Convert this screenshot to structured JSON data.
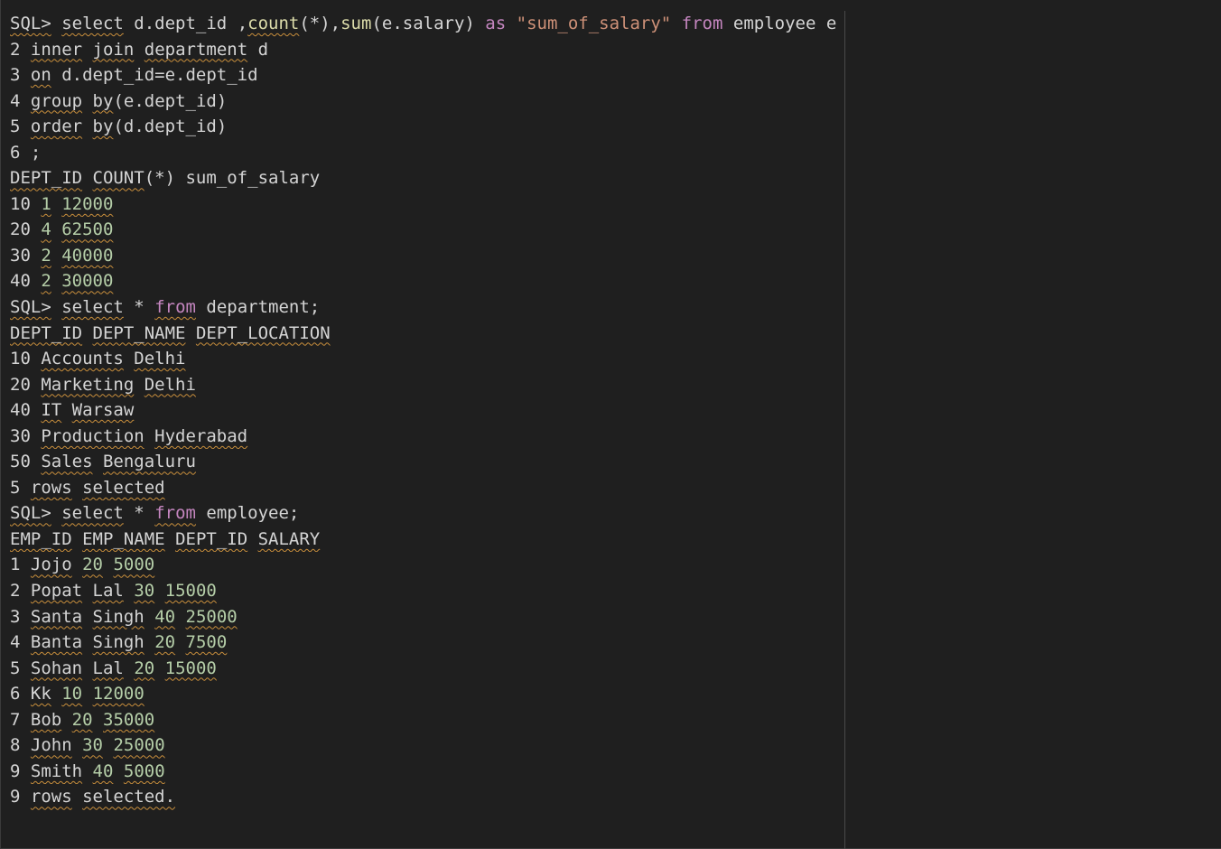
{
  "editor": {
    "lines": [
      [
        {
          "text": "SQL>",
          "kind": "plain",
          "squiggle": true
        },
        {
          "text": " ",
          "kind": "plain"
        },
        {
          "text": "select",
          "kind": "plain",
          "squiggle": true
        },
        {
          "text": " d.dept_id ,",
          "kind": "plain"
        },
        {
          "text": "count",
          "kind": "func",
          "squiggle": true
        },
        {
          "text": "(*),",
          "kind": "plain"
        },
        {
          "text": "sum",
          "kind": "func"
        },
        {
          "text": "(e.salary) ",
          "kind": "plain"
        },
        {
          "text": "as",
          "kind": "keyword"
        },
        {
          "text": " ",
          "kind": "plain"
        },
        {
          "text": "\"sum_of_salary\"",
          "kind": "string"
        },
        {
          "text": " ",
          "kind": "plain"
        },
        {
          "text": "from",
          "kind": "keyword"
        },
        {
          "text": " employee e",
          "kind": "plain"
        }
      ],
      [
        {
          "text": "2 ",
          "kind": "plain"
        },
        {
          "text": "inner",
          "kind": "plain",
          "squiggle": true
        },
        {
          "text": " ",
          "kind": "plain"
        },
        {
          "text": "join",
          "kind": "plain",
          "squiggle": true
        },
        {
          "text": " ",
          "kind": "plain"
        },
        {
          "text": "department",
          "kind": "plain",
          "squiggle": true
        },
        {
          "text": " d",
          "kind": "plain"
        }
      ],
      [
        {
          "text": "3 ",
          "kind": "plain"
        },
        {
          "text": "on",
          "kind": "plain",
          "squiggle": true
        },
        {
          "text": " d.dept_id=e.dept_id",
          "kind": "plain"
        }
      ],
      [
        {
          "text": "4 ",
          "kind": "plain"
        },
        {
          "text": "group",
          "kind": "plain",
          "squiggle": true
        },
        {
          "text": " ",
          "kind": "plain"
        },
        {
          "text": "by",
          "kind": "plain",
          "squiggle": true
        },
        {
          "text": "(e.dept_id)",
          "kind": "plain"
        }
      ],
      [
        {
          "text": "5 ",
          "kind": "plain"
        },
        {
          "text": "order",
          "kind": "plain",
          "squiggle": true
        },
        {
          "text": " ",
          "kind": "plain"
        },
        {
          "text": "by",
          "kind": "plain",
          "squiggle": true
        },
        {
          "text": "(d.dept_id)",
          "kind": "plain"
        }
      ],
      [
        {
          "text": "6 ;",
          "kind": "plain"
        }
      ],
      [
        {
          "text": "DEPT_ID",
          "kind": "plain",
          "squiggle": true
        },
        {
          "text": " ",
          "kind": "plain"
        },
        {
          "text": "COUNT",
          "kind": "plain",
          "squiggle": true
        },
        {
          "text": "(*) sum_of_salary",
          "kind": "plain"
        }
      ],
      [
        {
          "text": "10 ",
          "kind": "plain"
        },
        {
          "text": "1",
          "kind": "number",
          "squiggle": true
        },
        {
          "text": " ",
          "kind": "plain"
        },
        {
          "text": "12000",
          "kind": "number",
          "squiggle": true
        }
      ],
      [
        {
          "text": "20 ",
          "kind": "plain"
        },
        {
          "text": "4",
          "kind": "number",
          "squiggle": true
        },
        {
          "text": " ",
          "kind": "plain"
        },
        {
          "text": "62500",
          "kind": "number",
          "squiggle": true
        }
      ],
      [
        {
          "text": "30 ",
          "kind": "plain"
        },
        {
          "text": "2",
          "kind": "number",
          "squiggle": true
        },
        {
          "text": " ",
          "kind": "plain"
        },
        {
          "text": "40000",
          "kind": "number",
          "squiggle": true
        }
      ],
      [
        {
          "text": "40 ",
          "kind": "plain"
        },
        {
          "text": "2",
          "kind": "number",
          "squiggle": true
        },
        {
          "text": " ",
          "kind": "plain"
        },
        {
          "text": "30000",
          "kind": "number",
          "squiggle": true
        }
      ],
      [
        {
          "text": "SQL>",
          "kind": "plain",
          "squiggle": true
        },
        {
          "text": " ",
          "kind": "plain"
        },
        {
          "text": "select",
          "kind": "plain",
          "squiggle": true
        },
        {
          "text": " * ",
          "kind": "plain"
        },
        {
          "text": "from",
          "kind": "keyword",
          "squiggle": true
        },
        {
          "text": " department;",
          "kind": "plain"
        }
      ],
      [
        {
          "text": "DEPT_ID",
          "kind": "plain",
          "squiggle": true
        },
        {
          "text": " ",
          "kind": "plain"
        },
        {
          "text": "DEPT_NAME",
          "kind": "plain",
          "squiggle": true
        },
        {
          "text": " ",
          "kind": "plain"
        },
        {
          "text": "DEPT_LOCATION",
          "kind": "plain",
          "squiggle": true
        }
      ],
      [
        {
          "text": "10 ",
          "kind": "plain"
        },
        {
          "text": "Accounts",
          "kind": "plain",
          "squiggle": true
        },
        {
          "text": " ",
          "kind": "plain"
        },
        {
          "text": "Delhi",
          "kind": "plain",
          "squiggle": true
        }
      ],
      [
        {
          "text": "20 ",
          "kind": "plain"
        },
        {
          "text": "Marketing",
          "kind": "plain",
          "squiggle": true
        },
        {
          "text": " ",
          "kind": "plain"
        },
        {
          "text": "Delhi",
          "kind": "plain",
          "squiggle": true
        }
      ],
      [
        {
          "text": "40 ",
          "kind": "plain"
        },
        {
          "text": "IT",
          "kind": "plain",
          "squiggle": true
        },
        {
          "text": " ",
          "kind": "plain"
        },
        {
          "text": "Warsaw",
          "kind": "plain",
          "squiggle": true
        }
      ],
      [
        {
          "text": "30 ",
          "kind": "plain"
        },
        {
          "text": "Production",
          "kind": "plain",
          "squiggle": true
        },
        {
          "text": " ",
          "kind": "plain"
        },
        {
          "text": "Hyderabad",
          "kind": "plain",
          "squiggle": true
        }
      ],
      [
        {
          "text": "50 ",
          "kind": "plain"
        },
        {
          "text": "Sales",
          "kind": "plain",
          "squiggle": true
        },
        {
          "text": " ",
          "kind": "plain"
        },
        {
          "text": "Bengaluru",
          "kind": "plain",
          "squiggle": true
        }
      ],
      [
        {
          "text": "5 ",
          "kind": "plain"
        },
        {
          "text": "rows",
          "kind": "plain",
          "squiggle": true
        },
        {
          "text": " ",
          "kind": "plain"
        },
        {
          "text": "selected",
          "kind": "plain",
          "squiggle": true
        }
      ],
      [
        {
          "text": "SQL>",
          "kind": "plain",
          "squiggle": true
        },
        {
          "text": " ",
          "kind": "plain"
        },
        {
          "text": "select",
          "kind": "plain",
          "squiggle": true
        },
        {
          "text": " * ",
          "kind": "plain"
        },
        {
          "text": "from",
          "kind": "keyword",
          "squiggle": true
        },
        {
          "text": " employee;",
          "kind": "plain"
        }
      ],
      [
        {
          "text": "EMP_ID",
          "kind": "plain",
          "squiggle": true
        },
        {
          "text": " ",
          "kind": "plain"
        },
        {
          "text": "EMP_NAME",
          "kind": "plain",
          "squiggle": true
        },
        {
          "text": " ",
          "kind": "plain"
        },
        {
          "text": "DEPT_ID",
          "kind": "plain",
          "squiggle": true
        },
        {
          "text": " ",
          "kind": "plain"
        },
        {
          "text": "SALARY",
          "kind": "plain",
          "squiggle": true
        }
      ],
      [
        {
          "text": "1 ",
          "kind": "plain"
        },
        {
          "text": "Jojo",
          "kind": "plain",
          "squiggle": true
        },
        {
          "text": " ",
          "kind": "plain"
        },
        {
          "text": "20",
          "kind": "number",
          "squiggle": true
        },
        {
          "text": " ",
          "kind": "plain"
        },
        {
          "text": "5000",
          "kind": "number",
          "squiggle": true
        }
      ],
      [
        {
          "text": "2 ",
          "kind": "plain"
        },
        {
          "text": "Popat",
          "kind": "plain",
          "squiggle": true
        },
        {
          "text": " ",
          "kind": "plain"
        },
        {
          "text": "Lal",
          "kind": "plain",
          "squiggle": true
        },
        {
          "text": " ",
          "kind": "plain"
        },
        {
          "text": "30",
          "kind": "number",
          "squiggle": true
        },
        {
          "text": " ",
          "kind": "plain"
        },
        {
          "text": "15000",
          "kind": "number",
          "squiggle": true
        }
      ],
      [
        {
          "text": "3 ",
          "kind": "plain"
        },
        {
          "text": "Santa",
          "kind": "plain",
          "squiggle": true
        },
        {
          "text": " ",
          "kind": "plain"
        },
        {
          "text": "Singh",
          "kind": "plain",
          "squiggle": true
        },
        {
          "text": " ",
          "kind": "plain"
        },
        {
          "text": "40",
          "kind": "number",
          "squiggle": true
        },
        {
          "text": " ",
          "kind": "plain"
        },
        {
          "text": "25000",
          "kind": "number",
          "squiggle": true
        }
      ],
      [
        {
          "text": "4 ",
          "kind": "plain"
        },
        {
          "text": "Banta",
          "kind": "plain",
          "squiggle": true
        },
        {
          "text": " ",
          "kind": "plain"
        },
        {
          "text": "Singh",
          "kind": "plain",
          "squiggle": true
        },
        {
          "text": " ",
          "kind": "plain"
        },
        {
          "text": "20",
          "kind": "number",
          "squiggle": true
        },
        {
          "text": " ",
          "kind": "plain"
        },
        {
          "text": "7500",
          "kind": "number",
          "squiggle": true
        }
      ],
      [
        {
          "text": "5 ",
          "kind": "plain"
        },
        {
          "text": "Sohan",
          "kind": "plain",
          "squiggle": true
        },
        {
          "text": " ",
          "kind": "plain"
        },
        {
          "text": "Lal",
          "kind": "plain",
          "squiggle": true
        },
        {
          "text": " ",
          "kind": "plain"
        },
        {
          "text": "20",
          "kind": "number",
          "squiggle": true
        },
        {
          "text": " ",
          "kind": "plain"
        },
        {
          "text": "15000",
          "kind": "number",
          "squiggle": true
        }
      ],
      [
        {
          "text": "6 ",
          "kind": "plain"
        },
        {
          "text": "Kk",
          "kind": "plain",
          "squiggle": true
        },
        {
          "text": " ",
          "kind": "plain"
        },
        {
          "text": "10",
          "kind": "number",
          "squiggle": true
        },
        {
          "text": " ",
          "kind": "plain"
        },
        {
          "text": "12000",
          "kind": "number",
          "squiggle": true
        }
      ],
      [
        {
          "text": "7 ",
          "kind": "plain"
        },
        {
          "text": "Bob",
          "kind": "plain",
          "squiggle": true
        },
        {
          "text": " ",
          "kind": "plain"
        },
        {
          "text": "20",
          "kind": "number",
          "squiggle": true
        },
        {
          "text": " ",
          "kind": "plain"
        },
        {
          "text": "35000",
          "kind": "number",
          "squiggle": true
        }
      ],
      [
        {
          "text": "8 ",
          "kind": "plain"
        },
        {
          "text": "John",
          "kind": "plain",
          "squiggle": true
        },
        {
          "text": " ",
          "kind": "plain"
        },
        {
          "text": "30",
          "kind": "number",
          "squiggle": true
        },
        {
          "text": " ",
          "kind": "plain"
        },
        {
          "text": "25000",
          "kind": "number",
          "squiggle": true
        }
      ],
      [
        {
          "text": "9 ",
          "kind": "plain"
        },
        {
          "text": "Smith",
          "kind": "plain",
          "squiggle": true
        },
        {
          "text": " ",
          "kind": "plain"
        },
        {
          "text": "40",
          "kind": "number",
          "squiggle": true
        },
        {
          "text": " ",
          "kind": "plain"
        },
        {
          "text": "5000",
          "kind": "number",
          "squiggle": true
        }
      ],
      [
        {
          "text": "9 ",
          "kind": "plain"
        },
        {
          "text": "rows",
          "kind": "plain",
          "squiggle": true
        },
        {
          "text": " ",
          "kind": "plain"
        },
        {
          "text": "selected.",
          "kind": "plain",
          "squiggle": true
        }
      ]
    ]
  }
}
